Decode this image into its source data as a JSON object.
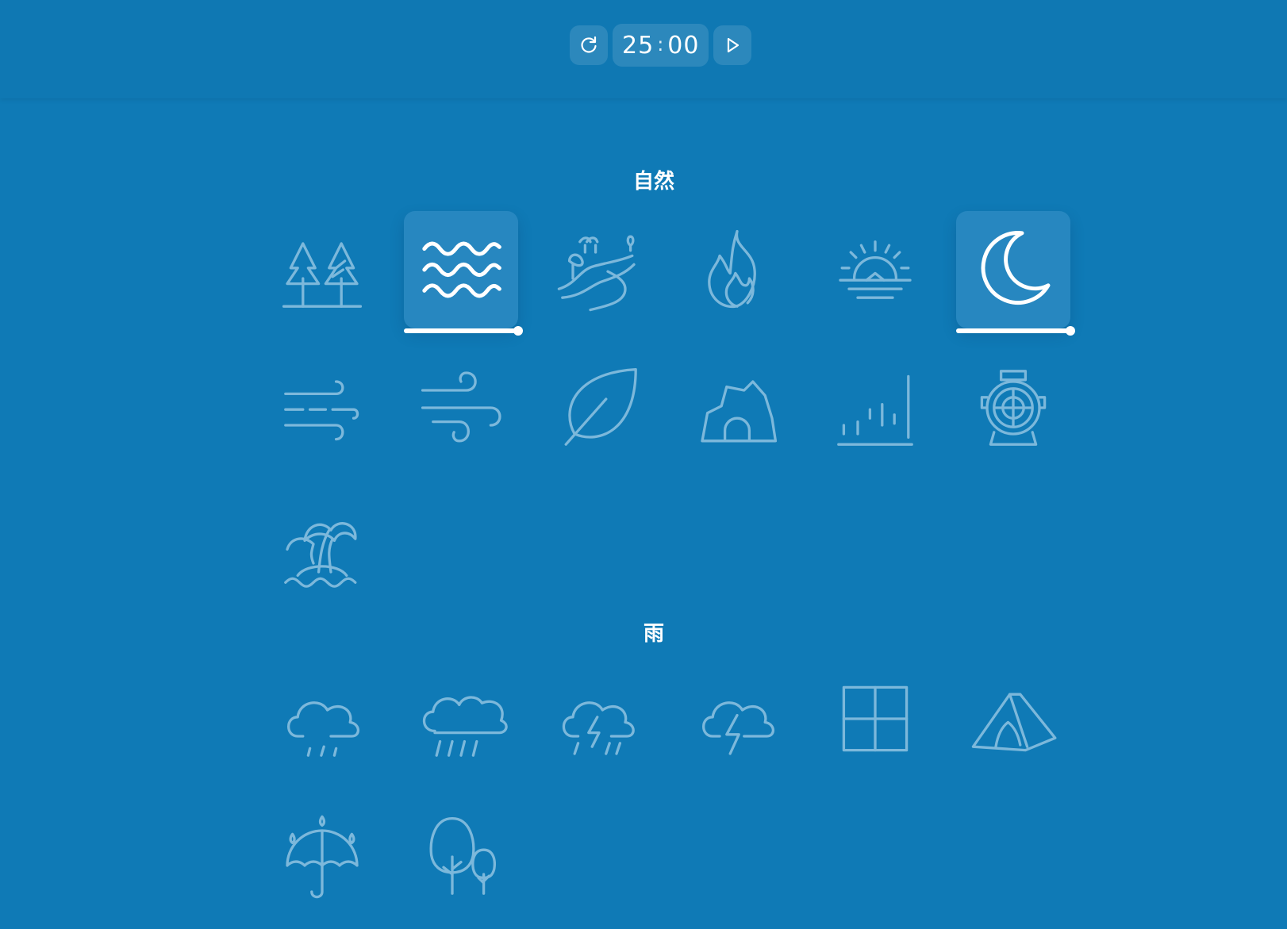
{
  "timer": {
    "minutes": "25",
    "separator": ":",
    "seconds": "00",
    "reset_icon": "refresh-icon",
    "play_icon": "play-icon"
  },
  "sections": [
    {
      "title": "自然",
      "sounds": [
        {
          "icon": "forest-icon",
          "active": false
        },
        {
          "icon": "waves-icon",
          "active": true,
          "volume": 1.0
        },
        {
          "icon": "river-icon",
          "active": false
        },
        {
          "icon": "fire-icon",
          "active": false
        },
        {
          "icon": "sunrise-icon",
          "active": false
        },
        {
          "icon": "moon-icon",
          "active": true,
          "volume": 1.0
        },
        {
          "icon": "wind-icon",
          "active": false
        },
        {
          "icon": "strong-wind-icon",
          "active": false
        },
        {
          "icon": "leaf-icon",
          "active": false
        },
        {
          "icon": "cave-icon",
          "active": false
        },
        {
          "icon": "drip-icon",
          "active": false
        },
        {
          "icon": "underwater-icon",
          "active": false
        },
        {
          "icon": "island-icon",
          "active": false
        }
      ]
    },
    {
      "title": "雨",
      "sounds": [
        {
          "icon": "light-rain-icon",
          "active": false
        },
        {
          "icon": "rain-icon",
          "active": false
        },
        {
          "icon": "thunderstorm-icon",
          "active": false
        },
        {
          "icon": "thunder-icon",
          "active": false
        },
        {
          "icon": "window-icon",
          "active": false
        },
        {
          "icon": "tent-icon",
          "active": false
        },
        {
          "icon": "umbrella-icon",
          "active": false
        },
        {
          "icon": "trees-rain-icon",
          "active": false
        }
      ]
    }
  ],
  "colors": {
    "background": "#0f7ab6",
    "tile_active": "#2787c0",
    "icon_inactive": "#8fc3e2",
    "icon_active": "#ffffff"
  }
}
